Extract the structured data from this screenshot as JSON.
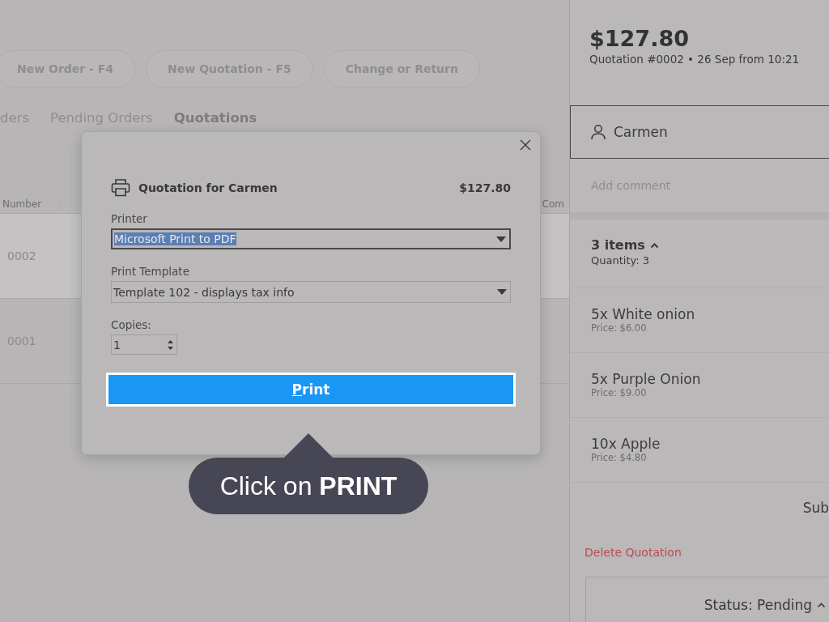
{
  "toolbar": {
    "buttons": [
      "New Order - F4",
      "New Quotation - F5",
      "Change or Return"
    ]
  },
  "tabs": [
    {
      "label": "ders",
      "selected": false
    },
    {
      "label": "Pending Orders",
      "selected": false
    },
    {
      "label": "Quotations",
      "selected": true
    }
  ],
  "table": {
    "columns": [
      "Number",
      "Com"
    ],
    "rows": [
      {
        "number": "0002",
        "selected": true
      },
      {
        "number": "0001",
        "selected": false
      }
    ]
  },
  "panel": {
    "total": "$127.80",
    "subtitle": "Quotation #0002  •  26 Sep from 10:21",
    "customer": "Carmen",
    "comment": {
      "placeholder": "Add comment"
    },
    "items_summary": {
      "title": "3 items",
      "expanded": true,
      "quantity": "Quantity: 3"
    },
    "items": [
      {
        "name": "5x White onion",
        "price": "Price: $6.00"
      },
      {
        "name": "5x Purple Onion",
        "price": "Price: $9.00"
      },
      {
        "name": "10x Apple",
        "price": "Price: $4.80"
      }
    ],
    "subtotal_label": "Sub",
    "delete_link": "Delete Quotation",
    "status": {
      "label": "Status: Pending",
      "expanded": true
    }
  },
  "dialog": {
    "title": "Quotation for Carmen",
    "amount": "$127.80",
    "fields": [
      {
        "kind": "select",
        "label": "Printer",
        "value": "Microsoft Print to PDF",
        "text_selected": true
      },
      {
        "kind": "select",
        "label": "Print Template",
        "value": "Template 102  - displays tax info",
        "text_selected": false
      },
      {
        "kind": "spinner",
        "label": "Copies:",
        "value": "1"
      }
    ],
    "button": {
      "label": "Print",
      "focused": true
    }
  },
  "tip": {
    "text": "Click on **PRINT**"
  }
}
